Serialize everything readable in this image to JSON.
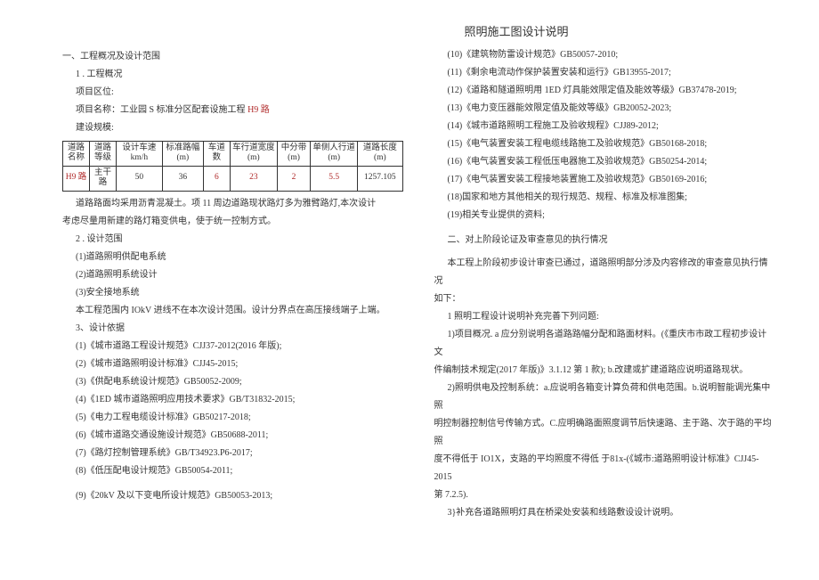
{
  "title": "照明施工图设计说明",
  "left": {
    "h1": "一、工程概况及设计范围",
    "s1": "1 . 工程概况",
    "p1": "项目区位:",
    "p2_a": "项目名称：工业园 S 标准分区配套设施工程 ",
    "p2_b": "H9 路",
    "p3": "建设规模:",
    "table": {
      "headers": [
        "道路名称",
        "道路等级",
        "设计车速 km/h",
        "标准路幅 (m)",
        "车道数",
        "车行道宽度 (m)",
        "中分带(m)",
        "单侧人行道 (m)",
        "道路长度(m)"
      ],
      "row": [
        "H9 路",
        "主干路",
        "50",
        "36",
        "6",
        "23",
        "2",
        "5.5",
        "1257.105"
      ]
    },
    "p4": "道路路面均采用沥青混凝土。项 11 周边道路现状路灯多为雅臂路灯,本次设计",
    "p4b": "考虑尽量用新建的路灯箱变供电，使于统一控制方式。",
    "s2": "2 . 设计范围",
    "l2_1": "(1)道路照明供配电系统",
    "l2_2": "(2)道路照明系统设计",
    "l2_3": "(3)安全接地系统",
    "p5": "本工程范围内 IOkV 进线不在本次设计范围。设计分界点在高压接线端子上端。",
    "s3": "3、设计依据",
    "l3_1": "(1)《城市道路工程设计规范》CJJ37-2012(2016 年版);",
    "l3_2": "(2)《城市道路照明设计标准》CJJ45-2015;",
    "l3_3": "(3)《供配电系统设计规范》GB50052-2009;",
    "l3_4": "(4)《1ED 城市道路照明应用技术要求》GB/T31832-2015;",
    "l3_5": "(5)《电力工程电缆设计标准》GB50217-2018;",
    "l3_6": "(6)《城市道路交通设施设计规范》GB50688-2011;",
    "l3_7": "(7)《路灯控制管理系统》GB/T34923.P6-2017;",
    "l3_8": "(8)《低压配电设计规范》GB50054-2011;",
    "l3_9": "(9)《20kV 及以下变电所设计规范》GB50053-2013;"
  },
  "right": {
    "l3_10": "(10)《建筑物防雷设计规范》GB50057-2010;",
    "l3_11": "(11)《剩余电流动作保护装置安装和运行》GB13955-2017;",
    "l3_12": "(12)《道路和隧道照明用 1ED 灯具能效限定值及能效等级》GB37478-2019;",
    "l3_13": "(13)《电力变压器能效限定值及能效等级》GB20052-2023;",
    "l3_14": "(14)《城市道路照明工程施工及验收规程》CJJ89-2012;",
    "l3_15": "(15)《电气装置安装工程电缆线路施工及验收规范》GB50168-2018;",
    "l3_16": "(16)《电气装置安装工程低压电器施工及验收规范》GB50254-2014;",
    "l3_17": "(17)《电气装置安装工程接地装置施工及验收规范》GB50169-2016;",
    "l3_18": "(18)国家和地方其他相关的现行规范、规程、标准及标准图集;",
    "l3_19": "(19)相关专业提供的资料;",
    "h2": "二、对上阶段论证及审查意见的执行情况",
    "p6a": "本工程上阶段初步设计审查已通过，道路照明部分涉及内容修改的审查意见执行情况",
    "p6b": "如下：",
    "p7": "1    照明工程设计说明补充完善下列问题:",
    "p8a": "1)项目概况. a 应分别说明各道路路幅分配和路面材料。(《重庆市市政工程初步设计文",
    "p8b": "件编制技术规定(2017 年版)》3.1.12 第 1 款); b.改建或扩建道路应说明道路现状。",
    "p9a": "2)照明供电及控制系统：a.应说明各箱变计算负荷和供电范围。b.说明智能调光集中照",
    "p9b": "明控制器控制信号传输方式。C.应明确路面照度调节后快速路、主于路、次于路的平均照",
    "p9c": "度不得低于 IO1X，支路的平均照度不得低 于81x-(《城市:道路照明设计标准》CJJ45-2015",
    "p9d": "第 7.2.5).",
    "p10": "3}补充各道路照明灯具在桥梁处安装和线路敷设设计说明。"
  }
}
